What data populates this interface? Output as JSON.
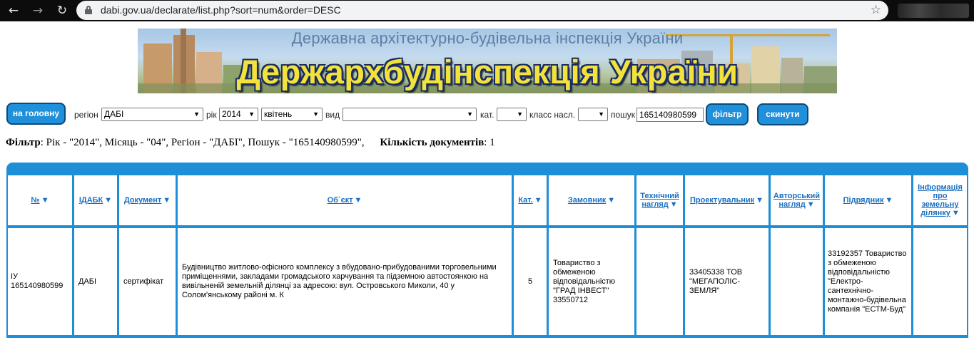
{
  "browser": {
    "url": "dabi.gov.ua/declarate/list.php?sort=num&order=DESC"
  },
  "banner": {
    "subtitle": "Державна архітектурно-будівельна інспекція України",
    "title": "Держархбудінспекція України"
  },
  "filters": {
    "home_button": "на головну",
    "region_label": "регіон",
    "region_value": "ДАБІ",
    "year_label": "рік",
    "year_value": "2014",
    "month_value": "квітень",
    "type_label": "вид",
    "type_value": "",
    "category_label": "кат.",
    "category_value": "",
    "class_label": "класс насл.",
    "class_value": "",
    "search_label": "пошук",
    "search_value": "165140980599",
    "filter_button": "фільтр",
    "reset_button": "скинути"
  },
  "filter_summary": {
    "filter_label": "Фільтр",
    "filter_text": ": Рік - \"2014\", Місяць - \"04\", Регіон - \"ДАБІ\", Пошук - \"165140980599\",",
    "count_label": "Кількість документів",
    "count_value": ": 1"
  },
  "table": {
    "headers": [
      "№",
      "ІДАБК",
      "Документ",
      "Об`єкт",
      "Кат.",
      "Замовник",
      "Технічний нагляд",
      "Проектувальник",
      "Авторський нагляд",
      "Підрядник",
      "Інформація про земельну ділянку"
    ],
    "rows": [
      {
        "num": "ІУ 165140980599",
        "idabk": "ДАБІ",
        "document": "сертифікат",
        "object": "Будівництво житлово-офісного комплексу з вбудовано-прибудованими торговельними приміщеннями, закладами громадського харчування та підземною автостоянкою на вивільненій земельній ділянці за адресою: вул. Островського Миколи, 40 у Солом'янському районі м. К",
        "category": "5",
        "customer": "Товариство з обмеженою відповідальністю \"ГРАД ІНВЕСТ\" 33550712",
        "tech_supervision": "",
        "designer": "33405338 ТОВ \"МЕГАПОЛІС-ЗЕМЛЯ\"",
        "author_supervision": "",
        "contractor": "33192357 Товариство з обмеженою відповідальністю \"Електро-сантехнічно-монтажно-будівельна компанія \"ЕСТМ-Буд\"",
        "land_info": ""
      }
    ]
  }
}
